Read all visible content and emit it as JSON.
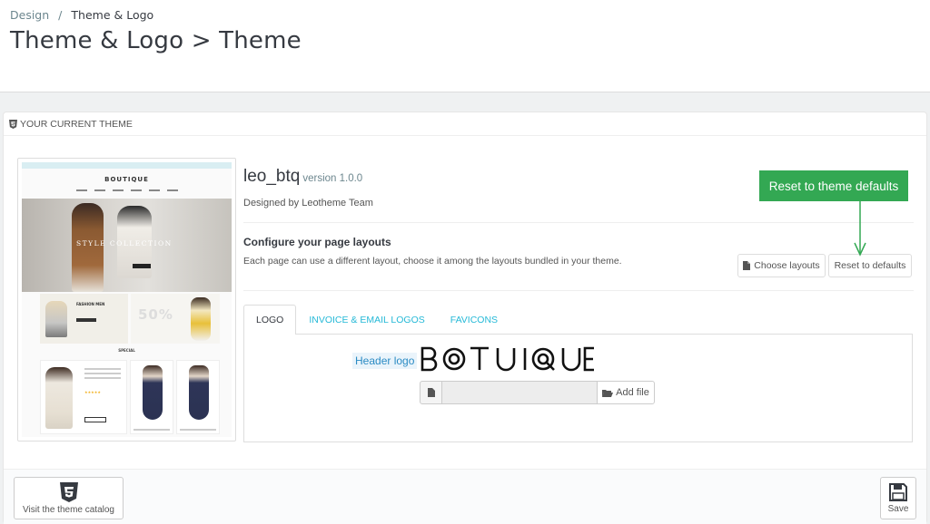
{
  "breadcrumb": {
    "parent": "Design",
    "separator": "/",
    "current": "Theme & Logo"
  },
  "page_title": "Theme & Logo > Theme",
  "panel": {
    "heading": "YOUR CURRENT THEME",
    "heading_icon": "html5-icon"
  },
  "preview": {
    "logo_text": "BOUTIQUE",
    "hero_text": "STYLE COLLECTION",
    "promo_left": "FASHION MEN",
    "promo_right": "50%",
    "section": "SPECIAL",
    "stars": "★★★★★"
  },
  "theme": {
    "name": "leo_btq",
    "version": "version 1.0.0",
    "designer": "Designed by Leotheme Team",
    "configure_title": "Configure your page layouts",
    "configure_desc": "Each page can use a different layout, choose it among the layouts bundled in your theme."
  },
  "buttons": {
    "choose_layouts": "Choose layouts",
    "reset_defaults": "Reset to defaults",
    "add_file": "Add file",
    "visit_catalog": "Visit the theme catalog",
    "save": "Save"
  },
  "callout": {
    "text": "Reset to theme defaults",
    "color": "#33a853"
  },
  "tabs": [
    {
      "label": "LOGO",
      "active": true
    },
    {
      "label": "INVOICE & EMAIL LOGOS",
      "active": false
    },
    {
      "label": "FAVICONS",
      "active": false
    }
  ],
  "logo_tab": {
    "header_logo_label": "Header logo",
    "header_logo_text": "BOUTIQUE",
    "file_value": ""
  },
  "colors": {
    "accent": "#25b9d7",
    "text": "#363a41",
    "muted": "#6c868e"
  }
}
